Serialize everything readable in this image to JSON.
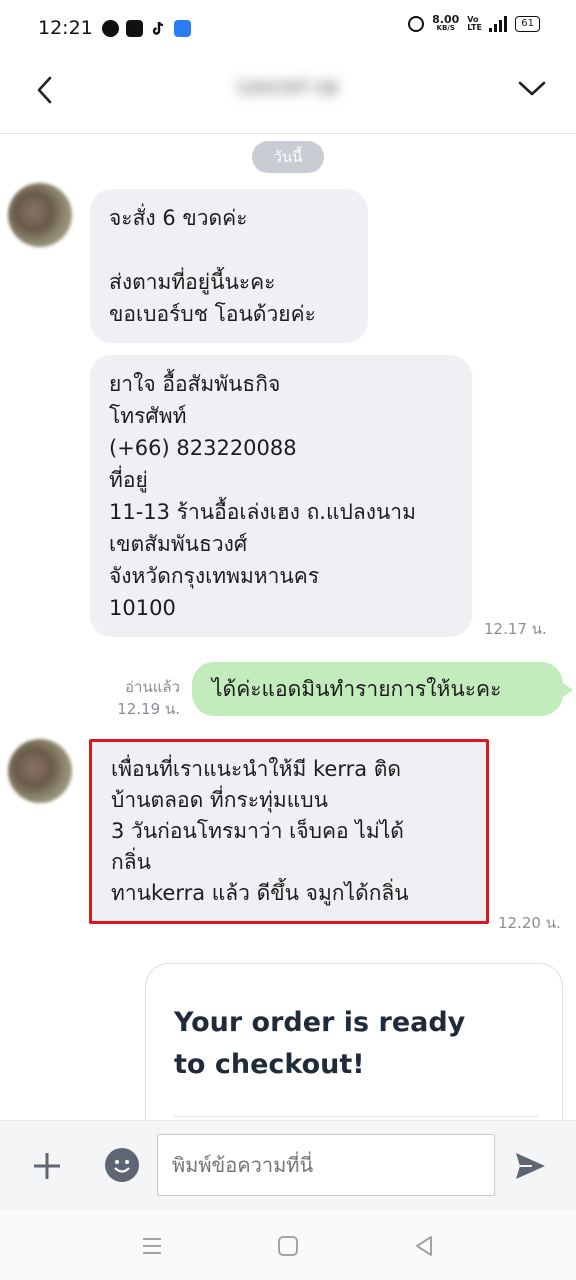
{
  "status_bar": {
    "time": "12:21",
    "net_speed": "8.00",
    "net_unit": "KB/S",
    "volte": "Vo LTE",
    "network": "4G",
    "battery": "61"
  },
  "header": {
    "title": "Lovcori sa",
    "back_icon": "chevron-left-icon",
    "menu_icon": "chevron-down-icon"
  },
  "chat": {
    "date_label": "วันนี้",
    "messages": [
      {
        "sender": "other",
        "text": "จะสั่ง 6 ขวดค่ะ\n\nส่งตามที่อยู่นี้นะคะ\nขอเบอร์บช โอนด้วยค่ะ"
      },
      {
        "sender": "other",
        "text": "ยาใจ อื้อสัมพันธกิจ\nโทรศัพท์\n(+66) 823220088\nที่อยู่\n11-13 ร้านอื้อเล่งเฮง ถ.แปลงนาม\nเขตสัมพันธวงศ์\nจังหวัดกรุงเทพมหานคร\n10100",
        "time": "12.17 น."
      },
      {
        "sender": "me",
        "text": "ได้ค่ะแอดมินทำรายการให้นะคะ",
        "read": "อ่านแล้ว",
        "time": "12.19 น."
      },
      {
        "sender": "other",
        "text": "เพื่อนที่เราแนะนำให้มี kerra ติด\nบ้านตลอด  ที่กระทุ่มแบน\n3 วันก่อนโทรมาว่า  เจ็บคอ  ไม่ได้\nกลิ่น\nทานkerra แล้ว ดีขึ้น  จมูกได้กลิ่น",
        "time": "12.20 น.",
        "highlighted": true
      }
    ],
    "card": {
      "title": "Your order is ready to checkout!"
    }
  },
  "input_bar": {
    "placeholder": "พิมพ์ข้อความที่นี่",
    "plus_icon": "plus-icon",
    "emoji_icon": "emoji-icon",
    "send_icon": "send-icon"
  },
  "nav_bar": {
    "menu_icon": "menu-icon",
    "home_icon": "home-icon",
    "back_icon": "back-icon"
  },
  "colors": {
    "sent_bubble": "#c2ecbc",
    "received_bubble": "#eff0f3",
    "highlight_border": "#e0141d",
    "time_text": "#8a8f97"
  }
}
